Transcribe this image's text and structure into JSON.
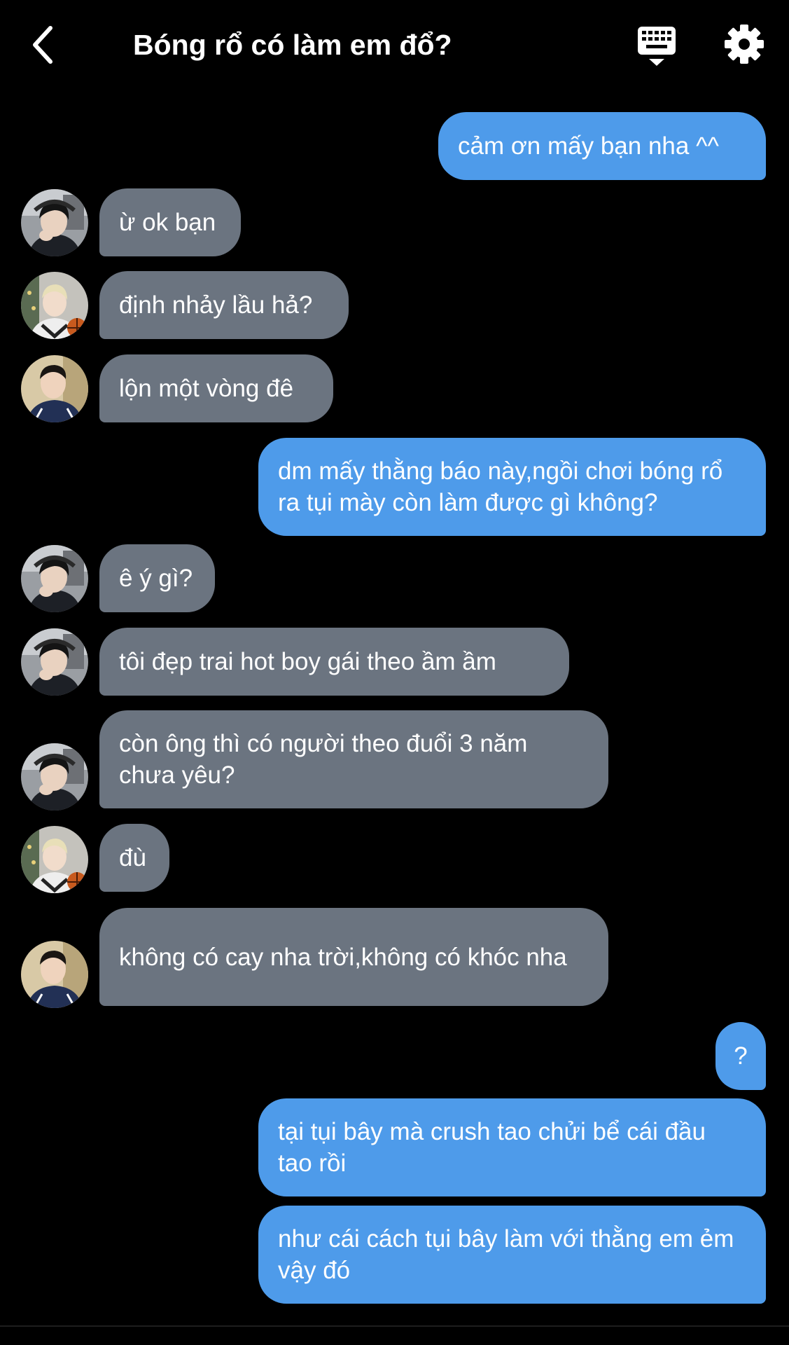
{
  "header": {
    "title": "Bóng rổ có làm em đổ?",
    "back_icon": "chevron-left-icon",
    "keyboard_icon": "keyboard-icon",
    "settings_icon": "gear-icon"
  },
  "colors": {
    "background": "#000000",
    "sent_bubble": "#4e9bea",
    "received_bubble": "#6b7480",
    "text": "#ffffff"
  },
  "messages": [
    {
      "sender": "me",
      "text": "cảm ơn mấy bạn nha ^^"
    },
    {
      "sender": "user-a",
      "text": "ừ ok bạn"
    },
    {
      "sender": "user-b",
      "text": "định nhảy lầu hả?"
    },
    {
      "sender": "user-c",
      "text": "lộn một vòng đê"
    },
    {
      "sender": "me",
      "text": "dm mấy thằng báo này,ngồi chơi bóng rổ ra tụi mày còn làm được gì không?"
    },
    {
      "sender": "user-a",
      "text": "ê ý gì?"
    },
    {
      "sender": "user-a",
      "text": "tôi đẹp trai hot boy gái theo ầm ầm"
    },
    {
      "sender": "user-a",
      "text": "còn ông thì có người theo đuổi 3 năm chưa yêu?"
    },
    {
      "sender": "user-b",
      "text": "đù"
    },
    {
      "sender": "user-c",
      "text": "không có cay nha trời,không có khóc nha"
    },
    {
      "sender": "me",
      "text": "?"
    },
    {
      "sender": "me",
      "text": "tại tụi bây mà crush tao chửi bể cái đầu tao rồi"
    },
    {
      "sender": "me",
      "text": "như cái cách tụi bây làm với thằng em ẻm vậy đó"
    }
  ]
}
